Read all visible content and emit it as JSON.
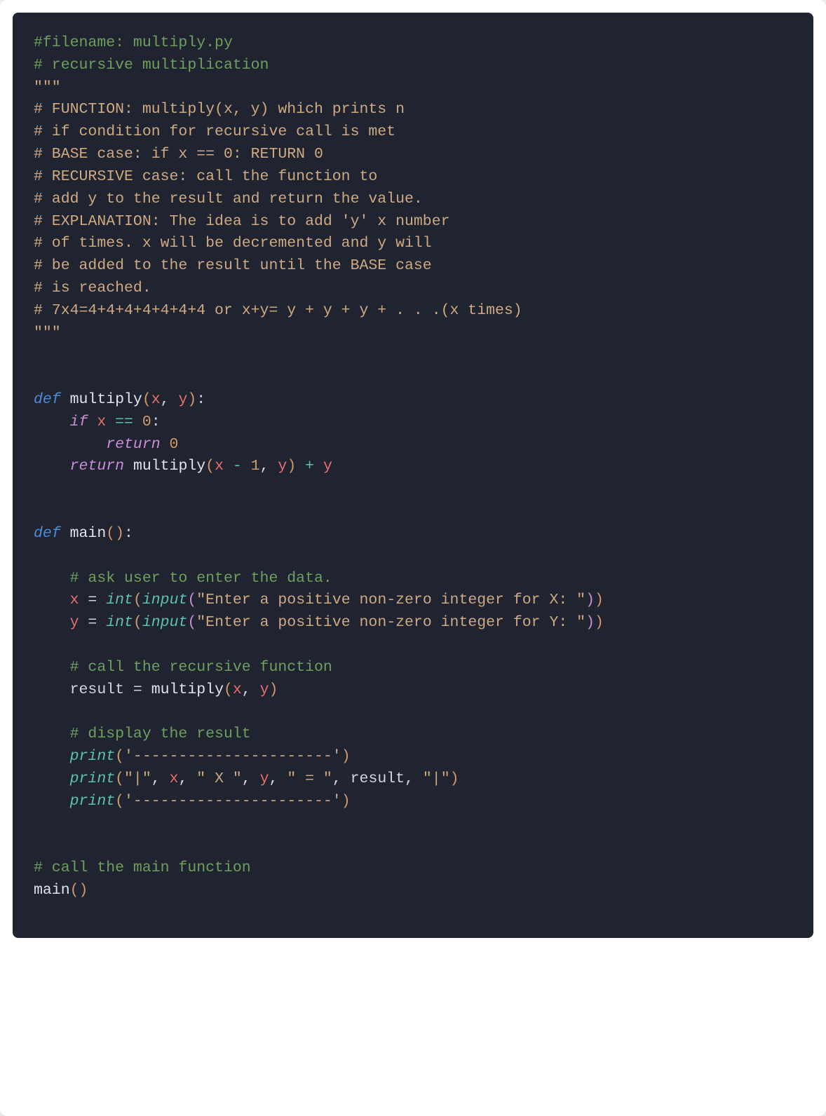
{
  "code": {
    "lines": {
      "l1_c": "#filename: multiply.py",
      "l2_c": "# recursive multiplication",
      "l3_q": "\"\"\"",
      "l4_d": "# FUNCTION: multiply(x, y) which prints n",
      "l5_d": "# if condition for recursive call is met",
      "l6_d": "# BASE case: if x == 0: RETURN 0",
      "l7_d": "# RECURSIVE case: call the function to",
      "l8_d": "# add y to the result and return the value.",
      "l9_d": "# EXPLANATION: The idea is to add 'y' x number",
      "l10_d": "# of times. x will be decremented and y will",
      "l11_d": "# be added to the result until the BASE case",
      "l12_d": "# is reached.",
      "l13_d": "# 7x4=4+4+4+4+4+4+4 or x+y= y + y + y + . . .(x times)",
      "l14_q": "\"\"\"",
      "l17_def": "def",
      "l17_name": " multiply",
      "l17_open": "(",
      "l17_x": "x",
      "l17_c": ", ",
      "l17_y": "y",
      "l17_close": ")",
      "l17_colon": ":",
      "l18_indent": "    ",
      "l18_if": "if",
      "l18_sp1": " ",
      "l18_x": "x",
      "l18_sp2": " ",
      "l18_eq": "==",
      "l18_sp3": " ",
      "l18_zero": "0",
      "l18_c": ":",
      "l19_indent": "        ",
      "l19_ret": "return",
      "l19_sp": " ",
      "l19_zero": "0",
      "l20_indent": "    ",
      "l20_ret": "return",
      "l20_sp1": " ",
      "l20_call": "multiply",
      "l20_open": "(",
      "l20_x": "x",
      "l20_sp2": " ",
      "l20_minus": "-",
      "l20_sp3": " ",
      "l20_one": "1",
      "l20_c": ", ",
      "l20_y": "y",
      "l20_close": ")",
      "l20_sp4": " ",
      "l20_plus": "+",
      "l20_sp5": " ",
      "l20_y2": "y",
      "l23_def": "def",
      "l23_name": " main",
      "l23_open": "(",
      "l23_close": ")",
      "l23_c": ":",
      "l25_indent": "    ",
      "l25_c": "# ask user to enter the data.",
      "l26_indent": "    ",
      "l26_x": "x",
      "l26_eq": " = ",
      "l26_int": "int",
      "l26_o1": "(",
      "l26_input": "input",
      "l26_o2": "(",
      "l26_str": "\"Enter a positive non-zero integer for X: \"",
      "l26_c2": ")",
      "l26_c1": ")",
      "l27_indent": "    ",
      "l27_y": "y",
      "l27_eq": " = ",
      "l27_int": "int",
      "l27_o1": "(",
      "l27_input": "input",
      "l27_o2": "(",
      "l27_str": "\"Enter a positive non-zero integer for Y: \"",
      "l27_c2": ")",
      "l27_c1": ")",
      "l29_indent": "    ",
      "l29_c": "# call the recursive function",
      "l30_indent": "    ",
      "l30_res": "result",
      "l30_eq": " = ",
      "l30_call": "multiply",
      "l30_open": "(",
      "l30_x": "x",
      "l30_c": ", ",
      "l30_y": "y",
      "l30_close": ")",
      "l32_indent": "    ",
      "l32_c": "# display the result",
      "l33_indent": "    ",
      "l33_print": "print",
      "l33_open": "(",
      "l33_str": "'----------------------'",
      "l33_close": ")",
      "l34_indent": "    ",
      "l34_print": "print",
      "l34_open": "(",
      "l34_s1": "\"|\"",
      "l34_c1": ", ",
      "l34_x": "x",
      "l34_c2": ", ",
      "l34_s2": "\" X \"",
      "l34_c3": ", ",
      "l34_y": "y",
      "l34_c4": ", ",
      "l34_s3": "\" = \"",
      "l34_c5": ", ",
      "l34_res": "result",
      "l34_c6": ", ",
      "l34_s4": "\"|\"",
      "l34_close": ")",
      "l35_indent": "    ",
      "l35_print": "print",
      "l35_open": "(",
      "l35_str": "'----------------------'",
      "l35_close": ")",
      "l38_c": "# call the main function",
      "l39_call": "main",
      "l39_open": "(",
      "l39_close": ")"
    }
  }
}
